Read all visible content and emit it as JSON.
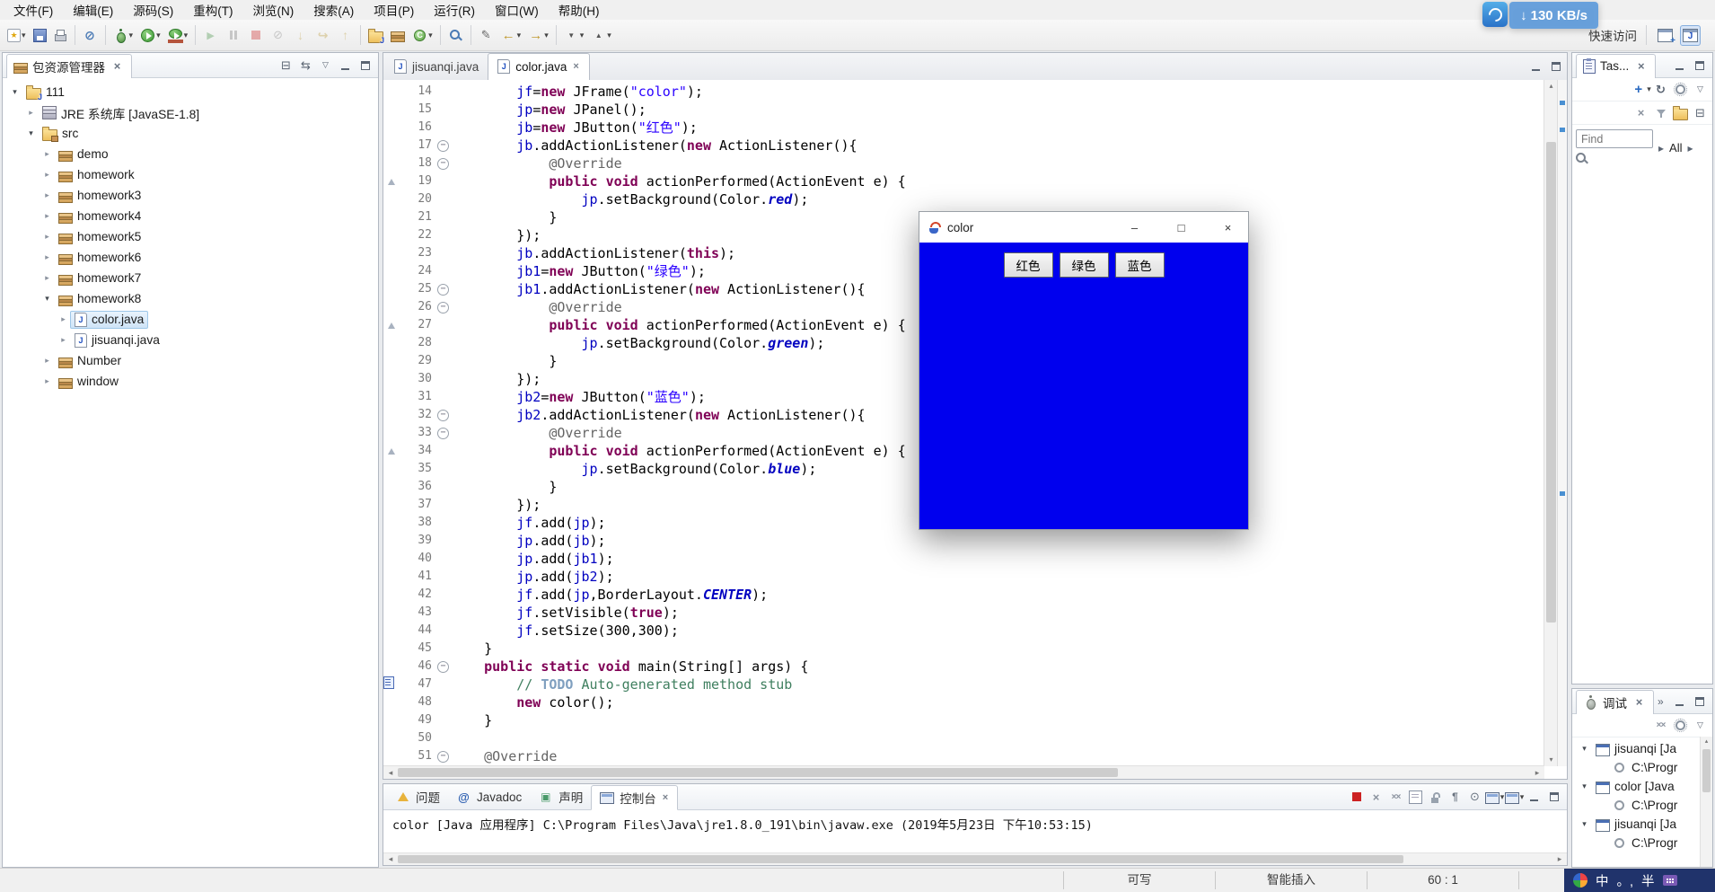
{
  "menu_items": [
    "文件(F)",
    "编辑(E)",
    "源码(S)",
    "重构(T)",
    "浏览(N)",
    "搜索(A)",
    "项目(P)",
    "运行(R)",
    "窗口(W)",
    "帮助(H)"
  ],
  "net_widget": {
    "speed": "130 KB/s",
    "arrow": "↓"
  },
  "quick_access_label": "快速访问",
  "toolbar_groups": [
    [
      {
        "name": "new",
        "dd": true
      },
      {
        "name": "save"
      },
      {
        "name": "print"
      }
    ],
    [
      {
        "name": "skip-breakpoints"
      }
    ],
    [
      {
        "name": "debug",
        "dd": true
      },
      {
        "name": "run",
        "dd": true
      },
      {
        "name": "external-tools",
        "dd": true
      }
    ],
    [
      {
        "name": "resume",
        "dis": true
      },
      {
        "name": "suspend",
        "dis": true
      },
      {
        "name": "terminate",
        "dis": true
      },
      {
        "name": "disconnect",
        "dis": true
      },
      {
        "name": "step-into",
        "dis": true
      },
      {
        "name": "step-over",
        "dis": true
      },
      {
        "name": "step-return",
        "dis": true
      }
    ],
    [
      {
        "name": "new-java-project"
      },
      {
        "name": "new-package"
      },
      {
        "name": "new-class",
        "dd": true
      }
    ],
    [
      {
        "name": "search"
      }
    ],
    [
      {
        "name": "last-edit"
      },
      {
        "name": "back",
        "dd": true
      },
      {
        "name": "forward",
        "dd": true
      }
    ],
    [
      {
        "name": "next-annotation",
        "dd": true
      },
      {
        "name": "prev-annotation",
        "dd": true
      }
    ]
  ],
  "package_explorer": {
    "title": "包资源管理器",
    "header_icons": [
      "collapse-all",
      "link-editor",
      "view-menu",
      "minimize",
      "maximize"
    ],
    "tree": [
      {
        "label": "111",
        "level": 0,
        "arrow": "down",
        "icon": "java-project"
      },
      {
        "label": "JRE 系统库 [JavaSE-1.8]",
        "level": 1,
        "arrow": "right",
        "icon": "library"
      },
      {
        "label": "src",
        "level": 1,
        "arrow": "down",
        "icon": "src-folder"
      },
      {
        "label": "demo",
        "level": 2,
        "arrow": "right",
        "icon": "package"
      },
      {
        "label": "homework",
        "level": 2,
        "arrow": "right",
        "icon": "package"
      },
      {
        "label": "homework3",
        "level": 2,
        "arrow": "right",
        "icon": "package"
      },
      {
        "label": "homework4",
        "level": 2,
        "arrow": "right",
        "icon": "package"
      },
      {
        "label": "homework5",
        "level": 2,
        "arrow": "right",
        "icon": "package"
      },
      {
        "label": "homework6",
        "level": 2,
        "arrow": "right",
        "icon": "package"
      },
      {
        "label": "homework7",
        "level": 2,
        "arrow": "right",
        "icon": "package"
      },
      {
        "label": "homework8",
        "level": 2,
        "arrow": "down",
        "icon": "package"
      },
      {
        "label": "color.java",
        "level": 3,
        "arrow": "right",
        "icon": "java-file",
        "selected": true
      },
      {
        "label": "jisuanqi.java",
        "level": 3,
        "arrow": "right",
        "icon": "java-file"
      },
      {
        "label": "Number",
        "level": 2,
        "arrow": "right",
        "icon": "package"
      },
      {
        "label": "window",
        "level": 2,
        "arrow": "right",
        "icon": "package"
      }
    ]
  },
  "editor": {
    "tabs": [
      {
        "label": "jisuanqi.java",
        "active": false
      },
      {
        "label": "color.java",
        "active": true
      }
    ],
    "tab_bar_icons": [
      "minimize",
      "maximize"
    ],
    "lines": [
      {
        "n": 14,
        "t": [
          [
            "p",
            "        "
          ],
          [
            "f",
            "jf"
          ],
          [
            "p",
            "="
          ],
          [
            "k",
            "new"
          ],
          [
            "p",
            " JFrame("
          ],
          [
            "s",
            "\"color\""
          ],
          [
            "p",
            ");"
          ]
        ]
      },
      {
        "n": 15,
        "t": [
          [
            "p",
            "        "
          ],
          [
            "f",
            "jp"
          ],
          [
            "p",
            "="
          ],
          [
            "k",
            "new"
          ],
          [
            "p",
            " JPanel();"
          ]
        ]
      },
      {
        "n": 16,
        "t": [
          [
            "p",
            "        "
          ],
          [
            "f",
            "jb"
          ],
          [
            "p",
            "="
          ],
          [
            "k",
            "new"
          ],
          [
            "p",
            " JButton("
          ],
          [
            "s",
            "\"红色\""
          ],
          [
            "p",
            ");"
          ]
        ]
      },
      {
        "n": 17,
        "fold": 1,
        "t": [
          [
            "p",
            "        "
          ],
          [
            "f",
            "jb"
          ],
          [
            "p",
            ".addActionListener("
          ],
          [
            "k",
            "new"
          ],
          [
            "p",
            " ActionListener(){"
          ]
        ]
      },
      {
        "n": 18,
        "fold": 1,
        "t": [
          [
            "p",
            "            "
          ],
          [
            "a",
            "@Override"
          ]
        ]
      },
      {
        "n": 19,
        "m": "ov",
        "t": [
          [
            "p",
            "            "
          ],
          [
            "k",
            "public"
          ],
          [
            "p",
            " "
          ],
          [
            "k",
            "void"
          ],
          [
            "p",
            " actionPerformed(ActionEvent e) {"
          ]
        ]
      },
      {
        "n": 20,
        "t": [
          [
            "p",
            "                "
          ],
          [
            "f",
            "jp"
          ],
          [
            "p",
            ".setBackground(Color."
          ],
          [
            "sf",
            "red"
          ],
          [
            "p",
            ");"
          ]
        ]
      },
      {
        "n": 21,
        "t": [
          [
            "p",
            "            }"
          ]
        ]
      },
      {
        "n": 22,
        "t": [
          [
            "p",
            "        });"
          ]
        ]
      },
      {
        "n": 23,
        "t": [
          [
            "p",
            "        "
          ],
          [
            "f",
            "jb"
          ],
          [
            "p",
            ".addActionListener("
          ],
          [
            "k",
            "this"
          ],
          [
            "p",
            ");"
          ]
        ]
      },
      {
        "n": 24,
        "t": [
          [
            "p",
            "        "
          ],
          [
            "f",
            "jb1"
          ],
          [
            "p",
            "="
          ],
          [
            "k",
            "new"
          ],
          [
            "p",
            " JButton("
          ],
          [
            "s",
            "\"绿色\""
          ],
          [
            "p",
            ");"
          ]
        ]
      },
      {
        "n": 25,
        "fold": 1,
        "t": [
          [
            "p",
            "        "
          ],
          [
            "f",
            "jb1"
          ],
          [
            "p",
            ".addActionListener("
          ],
          [
            "k",
            "new"
          ],
          [
            "p",
            " ActionListener(){"
          ]
        ]
      },
      {
        "n": 26,
        "fold": 1,
        "t": [
          [
            "p",
            "            "
          ],
          [
            "a",
            "@Override"
          ]
        ]
      },
      {
        "n": 27,
        "m": "ov",
        "t": [
          [
            "p",
            "            "
          ],
          [
            "k",
            "public"
          ],
          [
            "p",
            " "
          ],
          [
            "k",
            "void"
          ],
          [
            "p",
            " actionPerformed(ActionEvent e) {"
          ]
        ]
      },
      {
        "n": 28,
        "t": [
          [
            "p",
            "                "
          ],
          [
            "f",
            "jp"
          ],
          [
            "p",
            ".setBackground(Color."
          ],
          [
            "sf",
            "green"
          ],
          [
            "p",
            ");"
          ]
        ]
      },
      {
        "n": 29,
        "t": [
          [
            "p",
            "            }"
          ]
        ]
      },
      {
        "n": 30,
        "t": [
          [
            "p",
            "        });"
          ]
        ]
      },
      {
        "n": 31,
        "t": [
          [
            "p",
            "        "
          ],
          [
            "f",
            "jb2"
          ],
          [
            "p",
            "="
          ],
          [
            "k",
            "new"
          ],
          [
            "p",
            " JButton("
          ],
          [
            "s",
            "\"蓝色\""
          ],
          [
            "p",
            ");"
          ]
        ]
      },
      {
        "n": 32,
        "fold": 1,
        "t": [
          [
            "p",
            "        "
          ],
          [
            "f",
            "jb2"
          ],
          [
            "p",
            ".addActionListener("
          ],
          [
            "k",
            "new"
          ],
          [
            "p",
            " ActionListener(){"
          ]
        ]
      },
      {
        "n": 33,
        "fold": 1,
        "t": [
          [
            "p",
            "            "
          ],
          [
            "a",
            "@Override"
          ]
        ]
      },
      {
        "n": 34,
        "m": "ov",
        "t": [
          [
            "p",
            "            "
          ],
          [
            "k",
            "public"
          ],
          [
            "p",
            " "
          ],
          [
            "k",
            "void"
          ],
          [
            "p",
            " actionPerformed(ActionEvent e) {"
          ]
        ]
      },
      {
        "n": 35,
        "t": [
          [
            "p",
            "                "
          ],
          [
            "f",
            "jp"
          ],
          [
            "p",
            ".setBackground(Color."
          ],
          [
            "sf",
            "blue"
          ],
          [
            "p",
            ");"
          ]
        ]
      },
      {
        "n": 36,
        "t": [
          [
            "p",
            "            }"
          ]
        ]
      },
      {
        "n": 37,
        "t": [
          [
            "p",
            "        });"
          ]
        ]
      },
      {
        "n": 38,
        "t": [
          [
            "p",
            "        "
          ],
          [
            "f",
            "jf"
          ],
          [
            "p",
            ".add("
          ],
          [
            "f",
            "jp"
          ],
          [
            "p",
            ");"
          ]
        ]
      },
      {
        "n": 39,
        "t": [
          [
            "p",
            "        "
          ],
          [
            "f",
            "jp"
          ],
          [
            "p",
            ".add("
          ],
          [
            "f",
            "jb"
          ],
          [
            "p",
            ");"
          ]
        ]
      },
      {
        "n": 40,
        "t": [
          [
            "p",
            "        "
          ],
          [
            "f",
            "jp"
          ],
          [
            "p",
            ".add("
          ],
          [
            "f",
            "jb1"
          ],
          [
            "p",
            ");"
          ]
        ]
      },
      {
        "n": 41,
        "t": [
          [
            "p",
            "        "
          ],
          [
            "f",
            "jp"
          ],
          [
            "p",
            ".add("
          ],
          [
            "f",
            "jb2"
          ],
          [
            "p",
            ");"
          ]
        ]
      },
      {
        "n": 42,
        "t": [
          [
            "p",
            "        "
          ],
          [
            "f",
            "jf"
          ],
          [
            "p",
            ".add("
          ],
          [
            "f",
            "jp"
          ],
          [
            "p",
            ",BorderLayout."
          ],
          [
            "sf",
            "CENTER"
          ],
          [
            "p",
            ");"
          ]
        ]
      },
      {
        "n": 43,
        "t": [
          [
            "p",
            "        "
          ],
          [
            "f",
            "jf"
          ],
          [
            "p",
            ".setVisible("
          ],
          [
            "k",
            "true"
          ],
          [
            "p",
            ");"
          ]
        ]
      },
      {
        "n": 44,
        "t": [
          [
            "p",
            "        "
          ],
          [
            "f",
            "jf"
          ],
          [
            "p",
            ".setSize(300,300);"
          ]
        ]
      },
      {
        "n": 45,
        "t": [
          [
            "p",
            "    }"
          ]
        ]
      },
      {
        "n": 46,
        "fold": 1,
        "t": [
          [
            "p",
            "    "
          ],
          [
            "k",
            "public"
          ],
          [
            "p",
            " "
          ],
          [
            "k",
            "static"
          ],
          [
            "p",
            " "
          ],
          [
            "k",
            "void"
          ],
          [
            "p",
            " main(String[] args) {"
          ]
        ]
      },
      {
        "n": 47,
        "m": "task",
        "t": [
          [
            "p",
            "        "
          ],
          [
            "c",
            "// "
          ],
          [
            "t",
            "TODO"
          ],
          [
            "c",
            " Auto-generated method stub"
          ]
        ]
      },
      {
        "n": 48,
        "t": [
          [
            "p",
            "        "
          ],
          [
            "k",
            "new"
          ],
          [
            "p",
            " color();"
          ]
        ]
      },
      {
        "n": 49,
        "t": [
          [
            "p",
            "    }"
          ]
        ]
      },
      {
        "n": 50,
        "t": []
      },
      {
        "n": 51,
        "fold": 1,
        "t": [
          [
            "p",
            "    "
          ],
          [
            "a",
            "@Override"
          ]
        ]
      }
    ]
  },
  "app_window": {
    "title": "color",
    "panel_color": "#0000ee",
    "buttons": [
      "红色",
      "绿色",
      "蓝色"
    ],
    "controls": [
      "minimize",
      "maximize",
      "close"
    ],
    "control_glyphs": {
      "minimize": "–",
      "maximize": "□",
      "close": "×"
    }
  },
  "task_list": {
    "title": "Tas...",
    "header_icons": [
      "minimize",
      "maximize"
    ],
    "toolbar_row1": [
      {
        "name": "new-task",
        "dd": true
      },
      {
        "name": "sync"
      },
      {
        "name": "gear"
      },
      {
        "name": "view-menu"
      }
    ],
    "toolbar_row2": [
      {
        "name": "remove"
      },
      {
        "name": "filter"
      },
      {
        "name": "folder"
      },
      {
        "name": "collapse-all"
      }
    ],
    "find_placeholder": "Find",
    "all_label": "All"
  },
  "debug_view": {
    "title": "调试",
    "overflow_chevron": "»",
    "header_icons": [
      "minimize",
      "maximize"
    ],
    "toolbar_icons": [
      {
        "name": "remove-all"
      },
      {
        "name": "gear"
      },
      {
        "name": "view-menu"
      }
    ],
    "rows": [
      {
        "label": "jisuanqi [Ja",
        "level": 0,
        "arrow": "down",
        "icon": "java-app"
      },
      {
        "label": "C:\\Progr",
        "level": 1,
        "icon": "process"
      },
      {
        "label": "color [Java",
        "level": 0,
        "arrow": "down",
        "icon": "java-app"
      },
      {
        "label": "C:\\Progr",
        "level": 1,
        "icon": "process"
      },
      {
        "label": "jisuanqi [Ja",
        "level": 0,
        "arrow": "down",
        "icon": "java-app"
      },
      {
        "label": "C:\\Progr",
        "level": 1,
        "icon": "process"
      }
    ]
  },
  "console": {
    "tabs": [
      {
        "label": "问题",
        "icon": "problems",
        "active": false
      },
      {
        "label": "Javadoc",
        "icon": "javadoc",
        "active": false
      },
      {
        "label": "声明",
        "icon": "declaration",
        "active": false
      },
      {
        "label": "控制台",
        "icon": "console",
        "active": true
      }
    ],
    "toolbar_icons": [
      {
        "name": "terminate"
      },
      {
        "name": "remove-launch"
      },
      {
        "name": "remove-all"
      },
      {
        "name": "clear-console"
      },
      {
        "name": "scroll-lock"
      },
      {
        "name": "word-wrap"
      },
      {
        "name": "pin-console"
      },
      {
        "name": "display-console",
        "dd": true
      },
      {
        "name": "open-console",
        "dd": true
      },
      {
        "name": "minimize"
      },
      {
        "name": "maximize"
      }
    ],
    "text": "color [Java 应用程序] C:\\Program Files\\Java\\jre1.8.0_191\\bin\\javaw.exe  (2019年5月23日 下午10:53:15)"
  },
  "status_bar": {
    "writable": "可写",
    "insert_mode": "智能插入",
    "position": "60 : 1",
    "ime_cn": "中",
    "ime_punct": "。,",
    "ime_half": "半"
  }
}
